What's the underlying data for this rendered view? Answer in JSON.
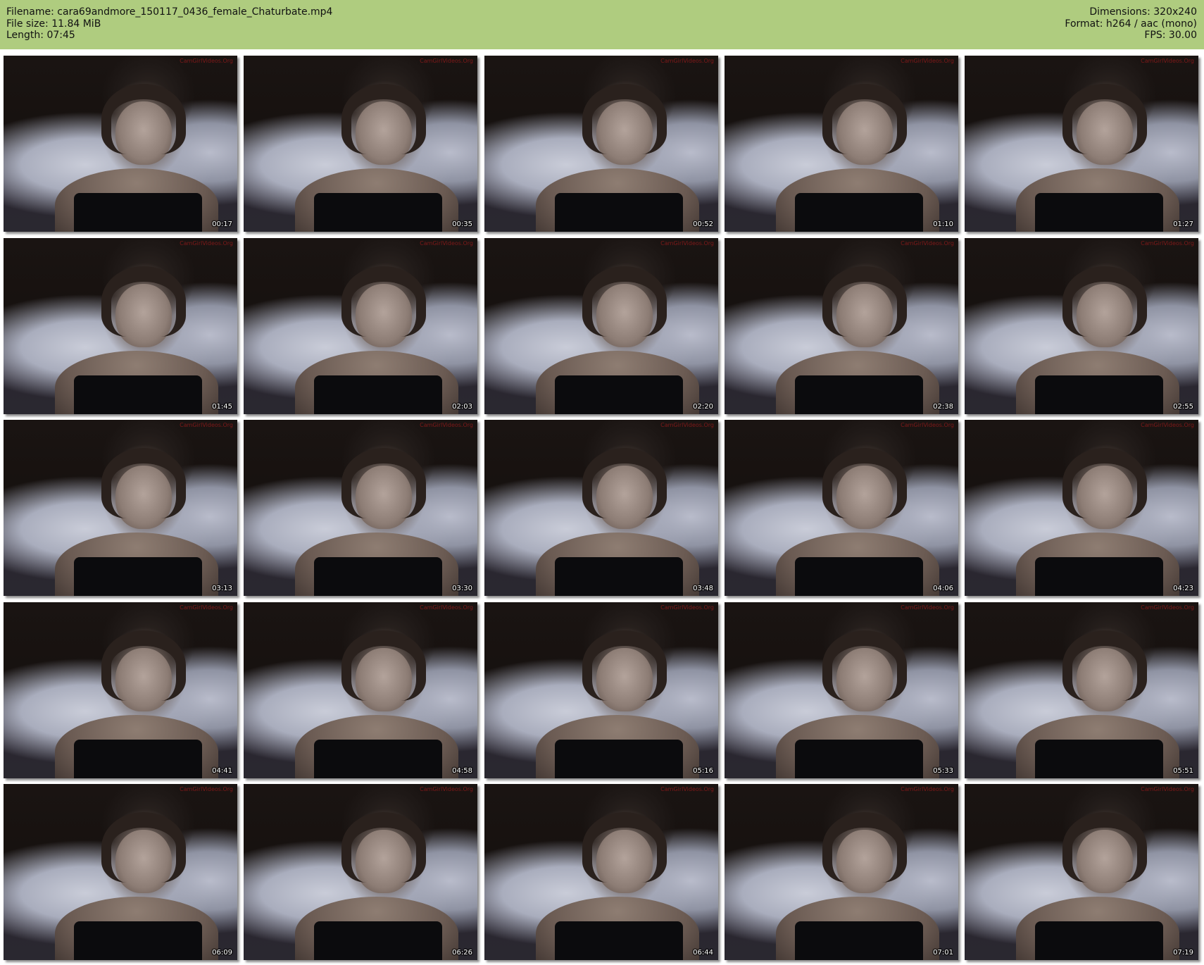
{
  "header": {
    "filename_label": "Filename: cara69andmore_150117_0436_female_Chaturbate.mp4",
    "filesize_label": "File size: 11.84 MiB",
    "length_label": "Length: 07:45",
    "dimensions_label": "Dimensions: 320x240",
    "format_label": "Format: h264 / aac (mono)",
    "fps_label": "FPS: 30.00",
    "background_color": "#afcc7f"
  },
  "watermark_text": "CamGirlVideos.Org",
  "thumbnails": [
    {
      "timestamp": "00:17"
    },
    {
      "timestamp": "00:35"
    },
    {
      "timestamp": "00:52"
    },
    {
      "timestamp": "01:10"
    },
    {
      "timestamp": "01:27"
    },
    {
      "timestamp": "01:45"
    },
    {
      "timestamp": "02:03"
    },
    {
      "timestamp": "02:20"
    },
    {
      "timestamp": "02:38"
    },
    {
      "timestamp": "02:55"
    },
    {
      "timestamp": "03:13"
    },
    {
      "timestamp": "03:30"
    },
    {
      "timestamp": "03:48"
    },
    {
      "timestamp": "04:06"
    },
    {
      "timestamp": "04:23"
    },
    {
      "timestamp": "04:41"
    },
    {
      "timestamp": "04:58"
    },
    {
      "timestamp": "05:16"
    },
    {
      "timestamp": "05:33"
    },
    {
      "timestamp": "05:51"
    },
    {
      "timestamp": "06:09"
    },
    {
      "timestamp": "06:26"
    },
    {
      "timestamp": "06:44"
    },
    {
      "timestamp": "07:01"
    },
    {
      "timestamp": "07:19"
    }
  ]
}
